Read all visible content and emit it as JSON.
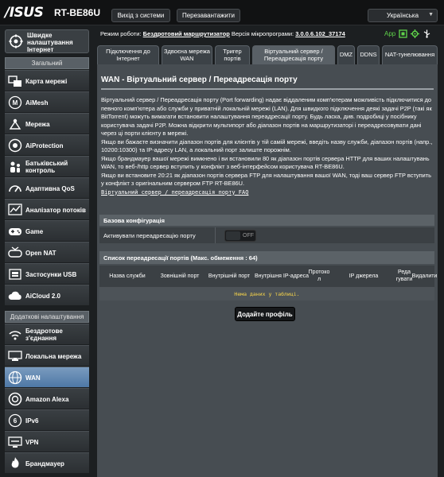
{
  "header": {
    "logo": "/ISUS",
    "model": "RT-BE86U",
    "logout_label": "Вихід з системи",
    "reboot_label": "Перезавантажити",
    "language": "Українська"
  },
  "status": {
    "mode_label": "Режим роботи:",
    "mode_value": "Бездротовий маршрутизатор",
    "fw_label": "Версія мікропрограми:",
    "fw_value": "3.0.0.6.102_37174",
    "app_label": "App"
  },
  "sidebar": {
    "quick_label": "Швидке налаштування Інтернет",
    "general_header": "Загальний",
    "general_items": [
      {
        "label": "Карта мережі",
        "icon": "network-map-icon"
      },
      {
        "label": "AiMesh",
        "icon": "aimesh-icon"
      },
      {
        "label": "Мережа",
        "icon": "network-icon"
      },
      {
        "label": "AiProtection",
        "icon": "shield-icon"
      },
      {
        "label": "Батьківський контроль",
        "icon": "parental-control-icon"
      },
      {
        "label": "Адаптивна QoS",
        "icon": "qos-icon"
      },
      {
        "label": "Аналізатор потоків",
        "icon": "traffic-analyzer-icon"
      },
      {
        "label": "Game",
        "icon": "gamepad-icon"
      },
      {
        "label": "Open NAT",
        "icon": "open-nat-icon"
      },
      {
        "label": "Застосунки USB",
        "icon": "usb-icon"
      },
      {
        "label": "AiCloud 2.0",
        "icon": "cloud-icon"
      }
    ],
    "advanced_header": "Додаткові налаштування",
    "advanced_items": [
      {
        "label": "Бездротове з'єднання",
        "icon": "wireless-icon"
      },
      {
        "label": "Локальна мережа",
        "icon": "lan-icon"
      },
      {
        "label": "WAN",
        "icon": "wan-globe-icon"
      },
      {
        "label": "Amazon Alexa",
        "icon": "alexa-icon"
      },
      {
        "label": "IPv6",
        "icon": "ipv6-icon"
      },
      {
        "label": "VPN",
        "icon": "vpn-icon"
      },
      {
        "label": "Брандмауер",
        "icon": "firewall-icon"
      }
    ]
  },
  "tabs": [
    "Підключення до Інтернет",
    "Здвоєна мережа WAN",
    "Тригер портів",
    "Віртуальний сервер / Переадресація порту",
    "DMZ",
    "DDNS",
    "NAT-тунелювання"
  ],
  "page": {
    "title": "WAN - Віртуальний сервер / Переадресація порту",
    "desc_p1": "Віртуальний сервер / Переадресація порту (Port forwarding) надає віддаленим комп'ютерам можливість підключитися до певного комп'ютера або служби у приватній локальній мережі (LAN). Для швидкого підключення деякі задачі P2P (такі як BitTorrent) можуть вимагати встановити налаштування переадресації порту. Будь ласка, див. подробиці у посібнику користувача задачі P2P. Можна відкрити мультипорт або діапазон портів на маршрутизаторі і переадресовувати дані через ці порти клієнту в мережі.",
    "desc_p2": "Якщо ви бажаєте визначити діапазон портів для клієнтів у тій самій мережі, введіть назву служби, діапазон портів (напр., 10200:10300) та IP-адресу LAN, а локальний порт залиште порожнім.",
    "desc_p3": "Якщо брандмауер вашої мережі вимкнено і ви встановили 80 як діапазон портів сервера HTTP для ваших налаштувань WAN, то веб-/http сервер вступить у конфлікт з веб-інтерфейсом користувача RT-BE86U.",
    "desc_p4": "Якщо ви встановите 20:21 як діапазон портів сервера FTP для налаштування вашої WAN, тоді ваш сервер FTP вступить у конфлікт з оригінальним сервером FTP RT-BE86U.",
    "faq_link": "Віртуальний сервер / переадресація порту FAQ",
    "basic_header": "Базова конфігурація",
    "enable_label": "Активувати переадресацію порту",
    "toggle_state": "OFF",
    "list_header": "Список переадресації портів (Макс. обмеження : 64)",
    "columns": [
      "Назва служби",
      "Зовнішній порт",
      "Внутрішній порт",
      "Внутрішня IP-адреса",
      "Протоко л",
      "IP джерела",
      "Реда гувати",
      "Видалити"
    ],
    "empty_text": "Нема даних у таблиці.",
    "add_label": "Додайте профіль"
  },
  "colors": {
    "background": "#1c1f21",
    "content": "#474d52",
    "active_nav": "#5f87b3",
    "status_green": "#5fd34a",
    "empty_text": "#f7d44a"
  }
}
